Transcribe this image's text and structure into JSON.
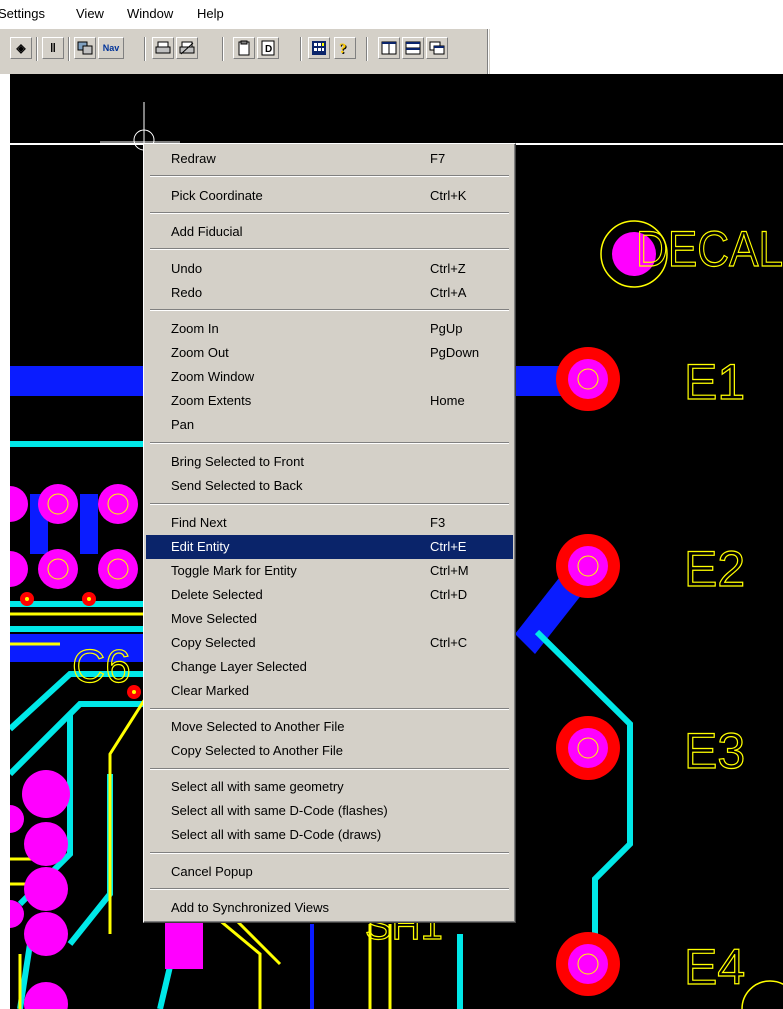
{
  "menubar": {
    "items": [
      "Settings",
      "View",
      "Window",
      "Help"
    ]
  },
  "toolbar": {
    "nav_label": "Nav",
    "icons": [
      "target-icon",
      "pin-icon",
      "layers-icon",
      "nav-icon",
      "print-icon",
      "print-preview-icon",
      "clipboard-icon",
      "d-icon",
      "calculator-icon",
      "help-icon",
      "tile-vertical-icon",
      "tile-horizontal-icon",
      "cascade-icon"
    ]
  },
  "pcb": {
    "labels": [
      "DECAL",
      "E1",
      "E2",
      "E3",
      "E4",
      "C6",
      "SH1"
    ],
    "colors": {
      "background": "#000000",
      "trace_blue": "#0a1cff",
      "trace_cyan": "#00e8e8",
      "trace_yellow": "#ffff00",
      "pad_red": "#ff0000",
      "pad_magenta": "#ff00ff",
      "crosshair": "#ffffff"
    }
  },
  "context_menu": {
    "highlight_color": "#0a246a",
    "items": [
      {
        "label": "Redraw",
        "shortcut": "F7"
      },
      {
        "label": "Pick Coordinate",
        "shortcut": "Ctrl+K"
      },
      {
        "label": "Add Fiducial",
        "shortcut": ""
      },
      {
        "label": "Undo",
        "shortcut": "Ctrl+Z"
      },
      {
        "label": "Redo",
        "shortcut": "Ctrl+A"
      },
      {
        "label": "Zoom In",
        "shortcut": "PgUp"
      },
      {
        "label": "Zoom Out",
        "shortcut": "PgDown"
      },
      {
        "label": "Zoom Window",
        "shortcut": ""
      },
      {
        "label": "Zoom Extents",
        "shortcut": "Home"
      },
      {
        "label": "Pan",
        "shortcut": ""
      },
      {
        "label": "Bring Selected to Front",
        "shortcut": ""
      },
      {
        "label": "Send Selected to Back",
        "shortcut": ""
      },
      {
        "label": "Find Next",
        "shortcut": "F3"
      },
      {
        "label": "Edit Entity",
        "shortcut": "Ctrl+E"
      },
      {
        "label": "Toggle Mark for Entity",
        "shortcut": "Ctrl+M"
      },
      {
        "label": "Delete Selected",
        "shortcut": "Ctrl+D"
      },
      {
        "label": "Move Selected",
        "shortcut": ""
      },
      {
        "label": "Copy Selected",
        "shortcut": "Ctrl+C"
      },
      {
        "label": "Change Layer Selected",
        "shortcut": ""
      },
      {
        "label": "Clear Marked",
        "shortcut": ""
      },
      {
        "label": "Move Selected to Another File",
        "shortcut": ""
      },
      {
        "label": "Copy Selected to Another File",
        "shortcut": ""
      },
      {
        "label": "Select all with same geometry",
        "shortcut": ""
      },
      {
        "label": "Select all with same D-Code (flashes)",
        "shortcut": ""
      },
      {
        "label": "Select all with same D-Code (draws)",
        "shortcut": ""
      },
      {
        "label": "Cancel Popup",
        "shortcut": ""
      },
      {
        "label": "Add to Synchronized Views",
        "shortcut": ""
      }
    ]
  }
}
